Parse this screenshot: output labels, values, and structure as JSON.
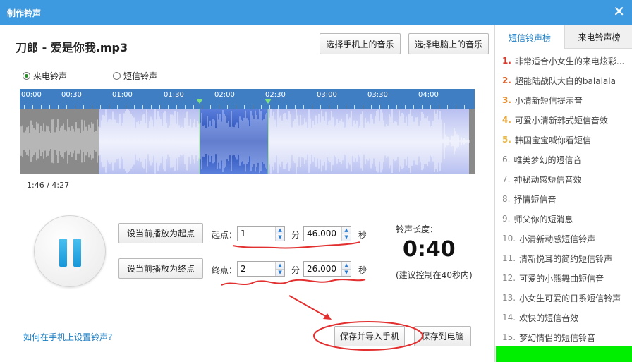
{
  "window": {
    "title": "制作铃声",
    "close_glyph": "✕"
  },
  "song": {
    "title": "刀郎 - 爱是你我.mp3"
  },
  "toolbar": {
    "phone_music": "选择手机上的音乐",
    "pc_music": "选择电脑上的音乐"
  },
  "mode": {
    "call_label": "来电铃声",
    "sms_label": "短信铃声",
    "selected": "来电铃声"
  },
  "timeline": {
    "ticks": [
      "00:00",
      "00:30",
      "01:00",
      "01:30",
      "02:00",
      "02:30",
      "03:00",
      "03:30",
      "04:00"
    ],
    "duration_seconds": 267,
    "selection_start_seconds": 106,
    "selection_end_seconds": 146
  },
  "playback": {
    "position": "1:46 / 4:27",
    "state": "pause-icon"
  },
  "controls": {
    "set_start": "设当前播放为起点",
    "set_end": "设当前播放为终点",
    "start_label": "起点：",
    "end_label": "终点：",
    "min_unit": "分",
    "sec_unit": "秒",
    "start_min": "1",
    "start_sec": "46.000",
    "end_min": "2",
    "end_sec": "26.000"
  },
  "length": {
    "label": "铃声长度：",
    "value": "0:40",
    "hint": "(建议控制在40秒内)"
  },
  "actions": {
    "save_import": "保存并导入手机",
    "save_pc": "保存到电脑"
  },
  "help": {
    "link": "如何在手机上设置铃声?"
  },
  "sidebar": {
    "tabs": [
      "短信铃声榜",
      "来电铃声榜"
    ],
    "active_tab": "短信铃声榜",
    "items": [
      {
        "num": "1.",
        "title": "非常适合小女生的来电炫彩..."
      },
      {
        "num": "2.",
        "title": "超能陆战队大白的balalala"
      },
      {
        "num": "3.",
        "title": "小清新短信提示音"
      },
      {
        "num": "4.",
        "title": "可爱小清新韩式短信音效"
      },
      {
        "num": "5.",
        "title": "韩国宝宝喊你看短信"
      },
      {
        "num": "6.",
        "title": "唯美梦幻的短信音"
      },
      {
        "num": "7.",
        "title": "神秘动感短信音效"
      },
      {
        "num": "8.",
        "title": "抒情短信音"
      },
      {
        "num": "9.",
        "title": "师父你的短消息"
      },
      {
        "num": "10.",
        "title": "小清新动感短信铃声"
      },
      {
        "num": "11.",
        "title": "清新悦耳的简约短信铃声"
      },
      {
        "num": "12.",
        "title": "可爱的小熊舞曲短信音"
      },
      {
        "num": "13.",
        "title": "小女生可爱的日系短信铃声"
      },
      {
        "num": "14.",
        "title": "欢快的短信音效"
      },
      {
        "num": "15.",
        "title": "梦幻情侣的短信铃音"
      }
    ]
  },
  "colors": {
    "titlebar": "#3d9ae0",
    "timeline": "#3f7ec2",
    "selection": "#2f5fc0",
    "annotation_red": "#e23030",
    "accent_blue": "#1a7dc4"
  }
}
